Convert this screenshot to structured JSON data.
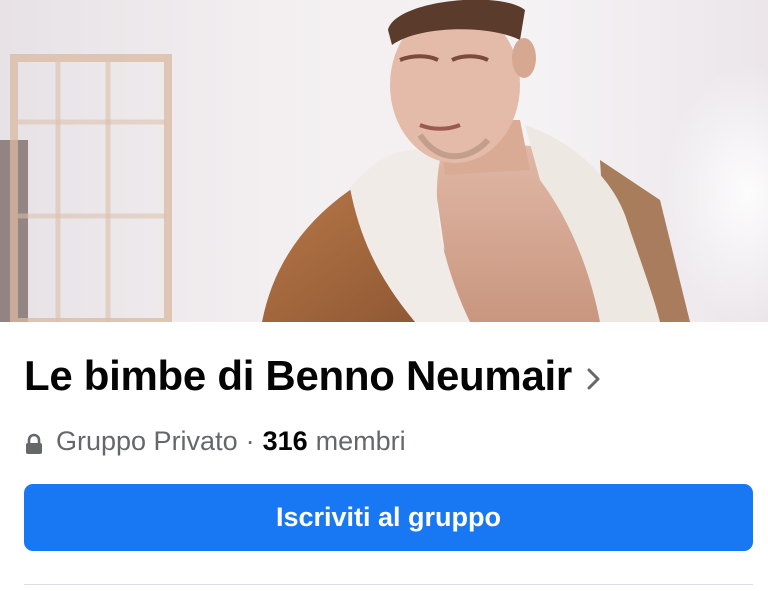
{
  "group": {
    "title": "Le bimbe di Benno Neumair",
    "privacy_label": "Gruppo Privato",
    "separator": "·",
    "member_count": "316",
    "members_label": "membri"
  },
  "actions": {
    "join_label": "Iscriviti al gruppo"
  },
  "icons": {
    "privacy": "lock-icon",
    "title_arrow": "chevron-right-icon"
  },
  "colors": {
    "accent": "#1877f2",
    "text_primary": "#050505",
    "text_secondary": "#65676b"
  }
}
